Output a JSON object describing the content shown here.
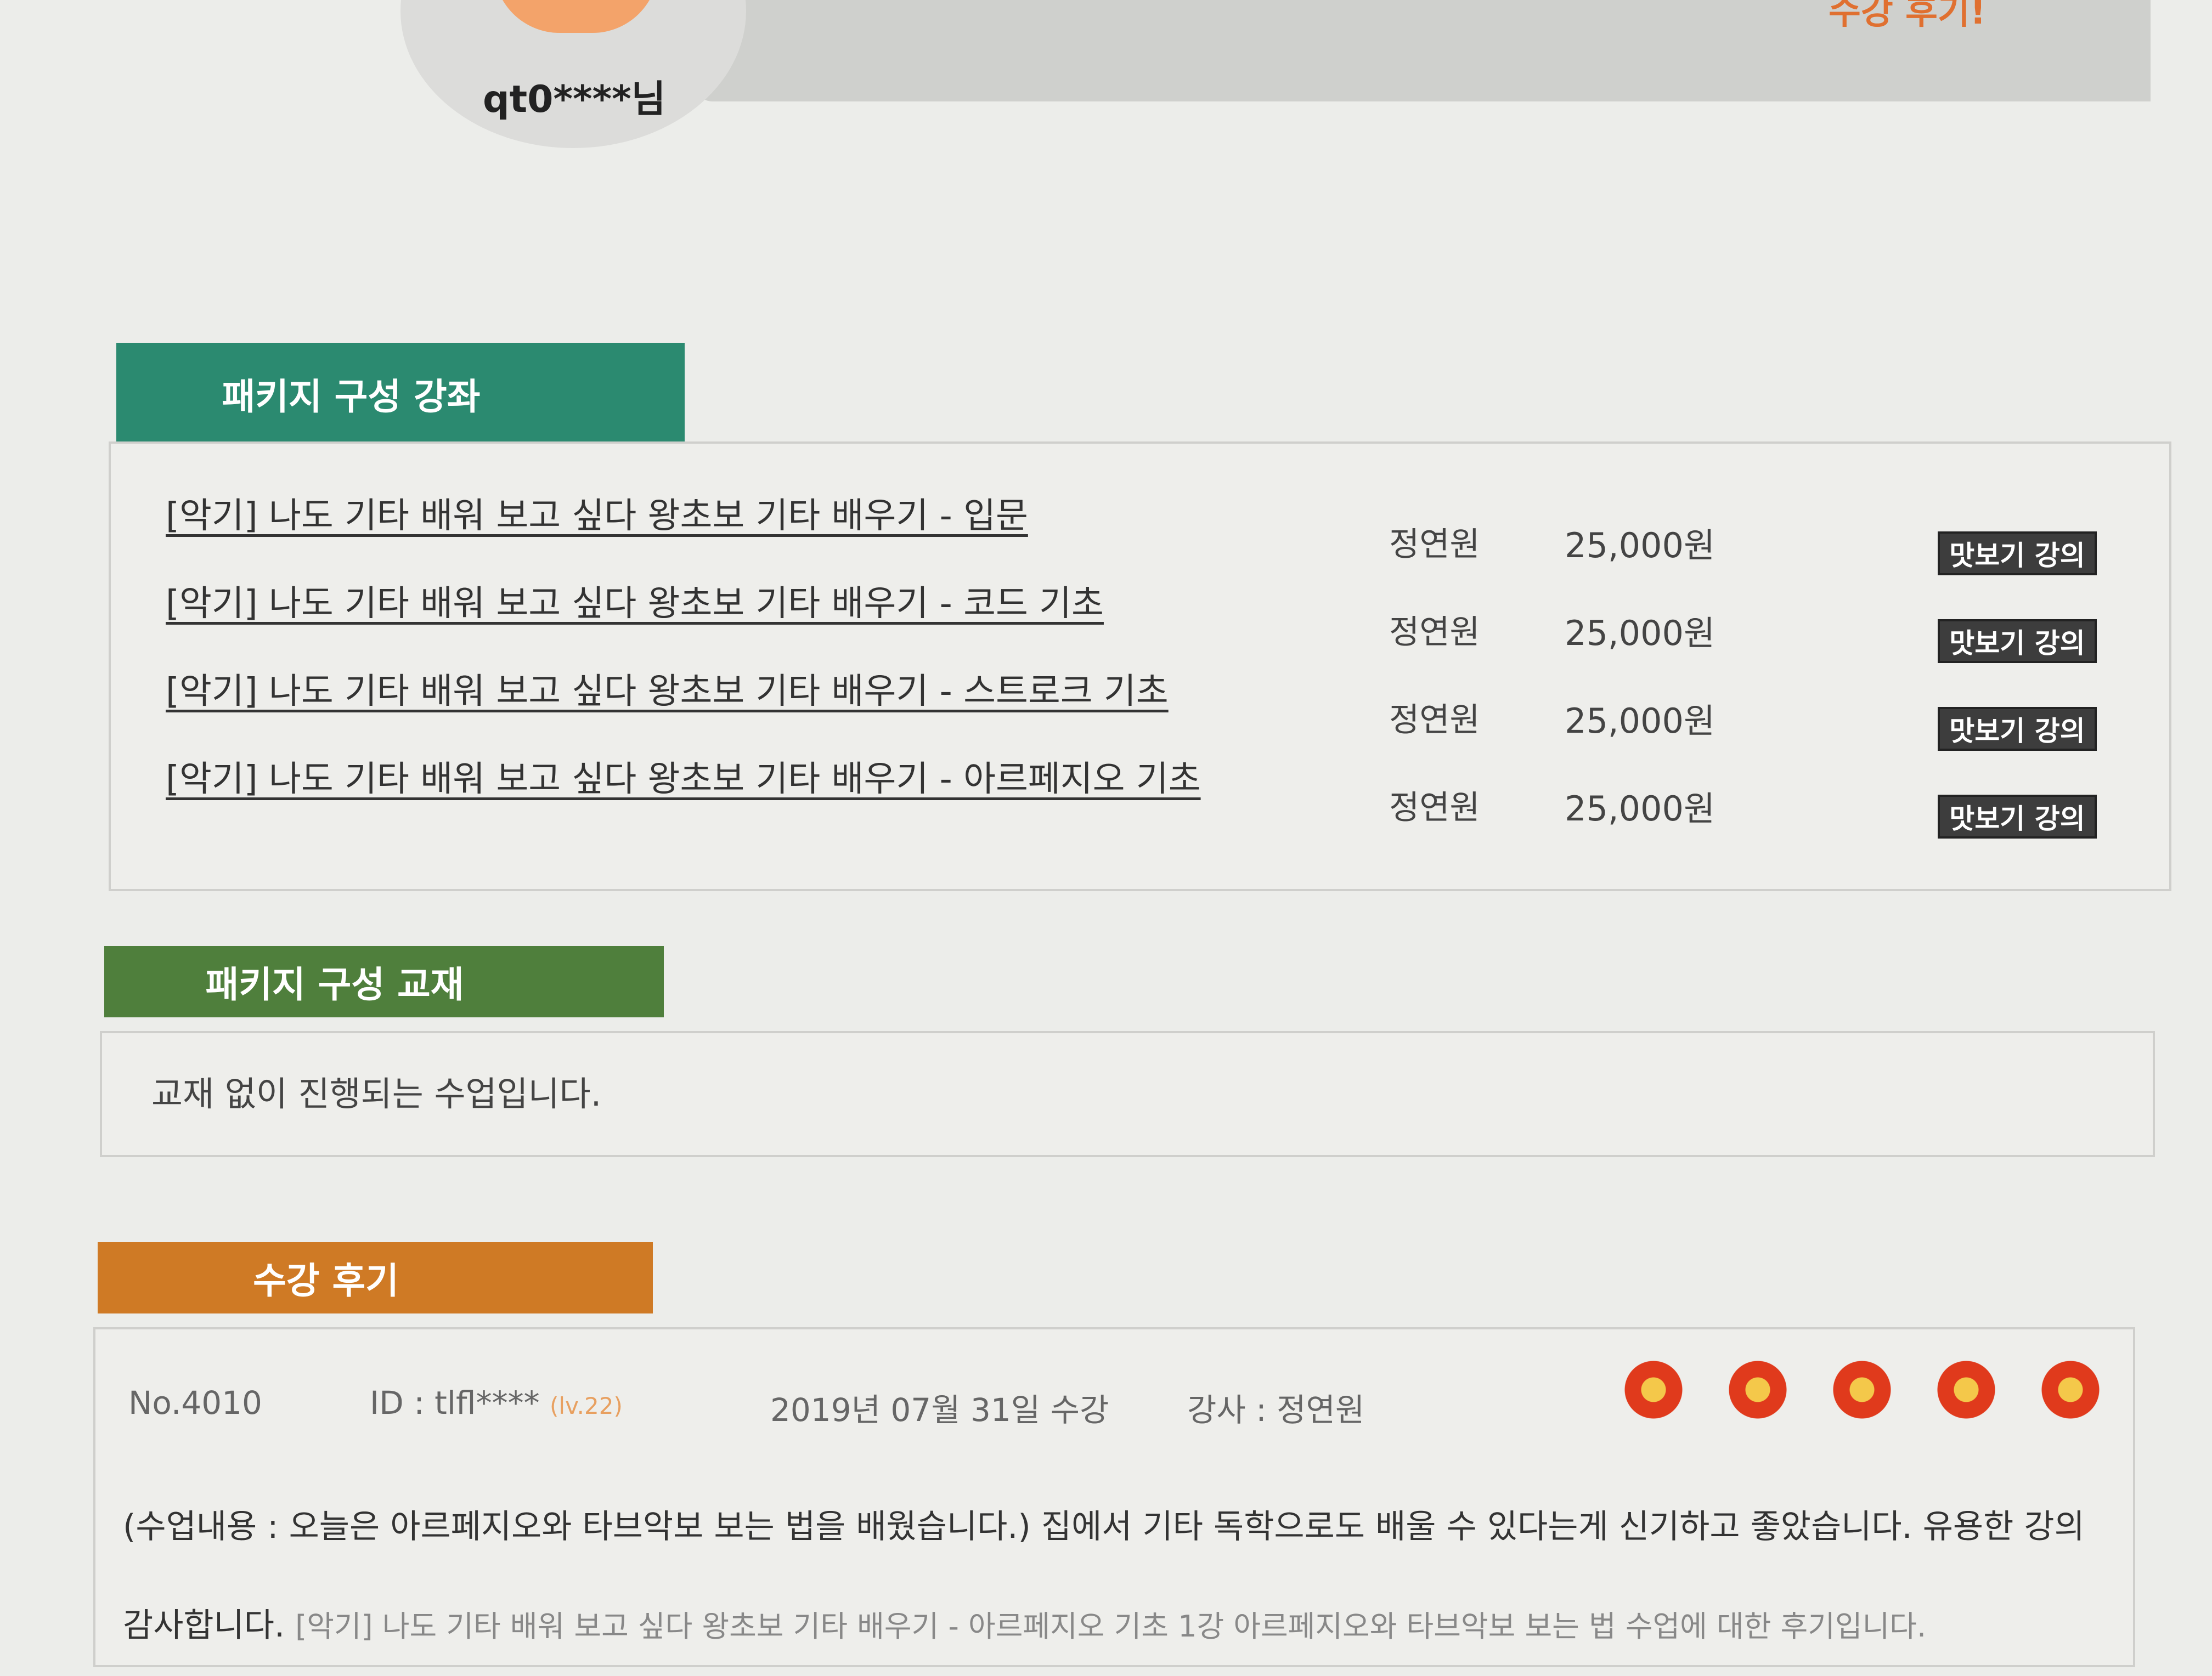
{
  "profile": {
    "username": "qt0****님"
  },
  "banner": {
    "text": "수강 후기!"
  },
  "sections": {
    "courses_header": "패키지 구성 강좌",
    "books_header": "패키지 구성 교재",
    "reviews_header": "수강 후기"
  },
  "courses": [
    {
      "title": "[악기] 나도 기타 배워 보고 싶다 왕초보 기타 배우기 - 입문",
      "teacher": "정연원",
      "price": "25,000원",
      "preview_label": "맛보기 강의"
    },
    {
      "title": "[악기] 나도 기타 배워 보고 싶다 왕초보 기타 배우기 - 코드 기초",
      "teacher": "정연원",
      "price": "25,000원",
      "preview_label": "맛보기 강의"
    },
    {
      "title": "[악기] 나도 기타 배워 보고 싶다 왕초보 기타 배우기 - 스트로크 기초",
      "teacher": "정연원",
      "price": "25,000원",
      "preview_label": "맛보기 강의"
    },
    {
      "title": "[악기] 나도 기타 배워 보고 싶다 왕초보 기타 배우기 - 아르페지오 기초",
      "teacher": "정연원",
      "price": "25,000원",
      "preview_label": "맛보기 강의"
    }
  ],
  "books": {
    "empty_message": "교재 없이 진행되는 수업입니다."
  },
  "review": {
    "number": "No.4010",
    "id": "ID : tlfl****",
    "level": "(lv.22)",
    "date": "2019년 07월 31일 수강",
    "teacher": "강사 : 정연원",
    "rating": 5,
    "body": "(수업내용 : 오늘은 아르페지오와 타브악보 보는 법을 배웠습니다.) 집에서 기타 독학으로도 배울 수 있다는게 신기하고 좋았습니다. 유용한 강의 감사합니다.",
    "course_ref": "[악기] 나도 기타 배워 보고 싶다 왕초보 기타 배우기 - 아르페지오 기초 1강 아르페지오와 타브악보 보는 법 수업에 대한 후기입니다."
  }
}
